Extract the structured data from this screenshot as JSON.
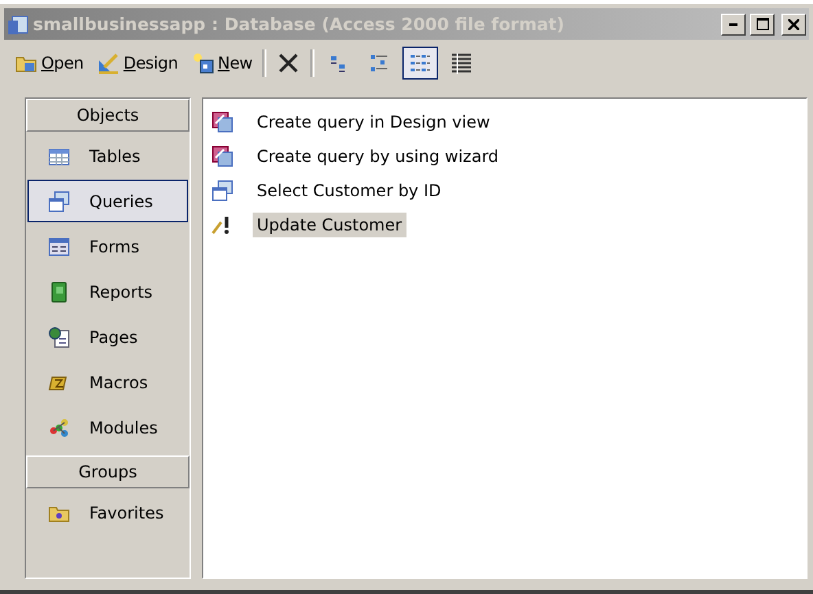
{
  "window": {
    "title": "smallbusinessapp : Database (Access 2000 file format)",
    "active": false
  },
  "toolbar": {
    "buttons": [
      {
        "label": "Open",
        "underline_first": true
      },
      {
        "label": "Design",
        "underline_first": true
      },
      {
        "label": "New",
        "underline_first": true
      }
    ],
    "views": [
      {
        "kind": "large",
        "selected": false
      },
      {
        "kind": "small",
        "selected": false
      },
      {
        "kind": "list",
        "selected": true
      },
      {
        "kind": "details",
        "selected": false
      }
    ]
  },
  "sidebar": {
    "sections": [
      {
        "header": "Objects",
        "items": [
          {
            "label": "Tables",
            "kind": "tables",
            "selected": false
          },
          {
            "label": "Queries",
            "kind": "queries",
            "selected": true
          },
          {
            "label": "Forms",
            "kind": "forms",
            "selected": false
          },
          {
            "label": "Reports",
            "kind": "reports",
            "selected": false
          },
          {
            "label": "Pages",
            "kind": "pages",
            "selected": false
          },
          {
            "label": "Macros",
            "kind": "macros",
            "selected": false
          },
          {
            "label": "Modules",
            "kind": "modules",
            "selected": false
          }
        ]
      },
      {
        "header": "Groups",
        "items": [
          {
            "label": "Favorites",
            "kind": "favorites",
            "selected": false
          }
        ]
      }
    ]
  },
  "list": {
    "items": [
      {
        "label": "Create query in Design view",
        "kind": "shortcut",
        "selected": false
      },
      {
        "label": "Create query by using wizard",
        "kind": "shortcut",
        "selected": false
      },
      {
        "label": "Select Customer by ID",
        "kind": "select",
        "selected": false
      },
      {
        "label": "Update Customer",
        "kind": "update",
        "selected": true
      }
    ]
  }
}
